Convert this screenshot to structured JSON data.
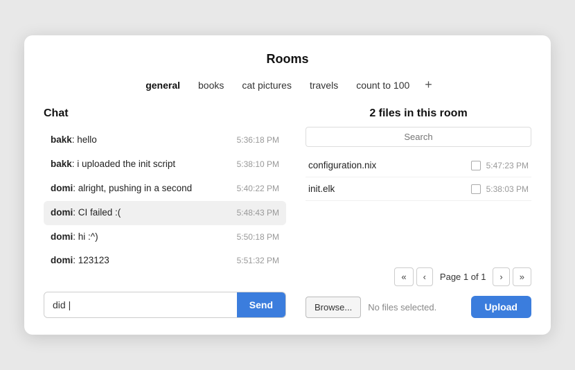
{
  "window": {
    "title": "Rooms"
  },
  "tabs": [
    {
      "id": "general",
      "label": "general",
      "active": true
    },
    {
      "id": "books",
      "label": "books",
      "active": false
    },
    {
      "id": "cat-pictures",
      "label": "cat pictures",
      "active": false
    },
    {
      "id": "travels",
      "label": "travels",
      "active": false
    },
    {
      "id": "count-to-100",
      "label": "count to 100",
      "active": false
    }
  ],
  "add_tab_icon": "+",
  "chat": {
    "title": "Chat",
    "messages": [
      {
        "sender": "bakk",
        "text": "hello",
        "time": "5:36:18 PM",
        "highlighted": false
      },
      {
        "sender": "bakk",
        "text": "i uploaded the init script",
        "time": "5:38:10 PM",
        "highlighted": false
      },
      {
        "sender": "domi",
        "text": "alright, pushing in a second",
        "time": "5:40:22 PM",
        "highlighted": false
      },
      {
        "sender": "domi",
        "text": "CI failed :(",
        "time": "5:48:43 PM",
        "highlighted": true
      },
      {
        "sender": "domi",
        "text": "hi :^)",
        "time": "5:50:18 PM",
        "highlighted": false
      },
      {
        "sender": "domi",
        "text": "123123",
        "time": "5:51:32 PM",
        "highlighted": false
      }
    ],
    "input_value": "did |",
    "input_placeholder": "",
    "send_label": "Send"
  },
  "files": {
    "title": "2 files in this room",
    "search_placeholder": "Search",
    "items": [
      {
        "name": "configuration.nix",
        "time": "5:47:23 PM"
      },
      {
        "name": "init.elk",
        "time": "5:38:03 PM"
      }
    ],
    "pagination": {
      "first_label": "«",
      "prev_label": "‹",
      "page_label": "Page 1 of 1",
      "next_label": "›",
      "last_label": "»"
    },
    "browse_label": "Browse...",
    "no_files_label": "No files selected.",
    "upload_label": "Upload"
  }
}
